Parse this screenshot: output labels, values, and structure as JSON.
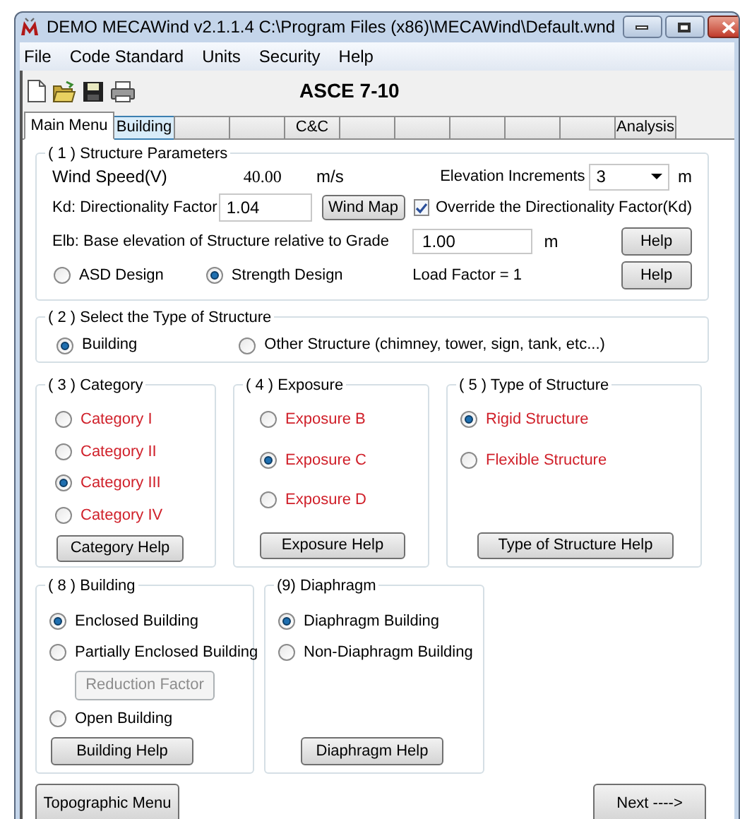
{
  "window": {
    "title": "DEMO MECAWind v2.1.1.4 C:\\Program Files (x86)\\MECAWind\\Default.wnd"
  },
  "menu": [
    "File",
    "Code Standard",
    "Units",
    "Security",
    "Help"
  ],
  "toolbar": {
    "title": "ASCE 7-10"
  },
  "tabs": [
    {
      "label": "Main Menu",
      "selected": true,
      "hover": false
    },
    {
      "label": "Building",
      "selected": false,
      "hover": true
    },
    {
      "selected": false,
      "hover": false
    },
    {
      "selected": false,
      "hover": false
    },
    {
      "label": "C&C",
      "selected": false,
      "hover": false
    },
    {
      "selected": false,
      "hover": false
    },
    {
      "selected": false,
      "hover": false
    },
    {
      "selected": false,
      "hover": false
    },
    {
      "selected": false,
      "hover": false
    },
    {
      "selected": false,
      "hover": false
    },
    {
      "label": "Analysis",
      "selected": false,
      "hover": false
    }
  ],
  "structure_parameters": {
    "title": "( 1 ) Structure Parameters",
    "wind_speed": {
      "label": "Wind Speed(V)",
      "value": "40.00",
      "unit": "m/s"
    },
    "elevation_increments": {
      "label": "Elevation Increments",
      "value": "3",
      "unit": "m"
    },
    "kd": {
      "label": "Kd: Directionality Factor",
      "value": "1.04"
    },
    "wind_map_button": "Wind Map",
    "override": {
      "label": "Override the Directionality Factor(Kd)",
      "checked": true
    },
    "elb": {
      "label": "Elb: Base elevation of Structure relative to Grade",
      "value": "1.00",
      "unit": "m"
    },
    "help_buttons": [
      "Help",
      "Help"
    ],
    "design": [
      {
        "label": "ASD Design",
        "selected": false
      },
      {
        "label": "Strength Design",
        "selected": true
      }
    ],
    "load_factor": "Load Factor =  1"
  },
  "structure_type": {
    "title": "( 2 ) Select the Type of Structure",
    "options": [
      {
        "label": "Building",
        "selected": true
      },
      {
        "label": "Other Structure (chimney, tower,  sign, tank, etc...)",
        "selected": false
      }
    ]
  },
  "category": {
    "title": "( 3 ) Category",
    "highlighted": true,
    "options": [
      {
        "label": "Category I",
        "selected": false
      },
      {
        "label": "Category II",
        "selected": false
      },
      {
        "label": "Category III",
        "selected": true
      },
      {
        "label": "Category IV",
        "selected": false
      }
    ],
    "help_button": "Category Help"
  },
  "exposure": {
    "title": "( 4 ) Exposure",
    "highlighted": true,
    "options": [
      {
        "label": "Exposure B",
        "selected": false
      },
      {
        "label": "Exposure C",
        "selected": true
      },
      {
        "label": "Exposure D",
        "selected": false
      }
    ],
    "help_button": "Exposure Help"
  },
  "type_of_structure": {
    "title": "( 5 ) Type of Structure",
    "highlighted": true,
    "options": [
      {
        "label": "Rigid Structure",
        "selected": true
      },
      {
        "label": "Flexible Structure",
        "selected": false
      }
    ],
    "help_button": "Type of Structure Help"
  },
  "building": {
    "title": "( 8 ) Building",
    "items": [
      {
        "kind": "radio",
        "label": "Enclosed Building",
        "selected": true
      },
      {
        "kind": "radio",
        "label": "Partially Enclosed Building",
        "selected": false
      },
      {
        "kind": "button",
        "label": "Reduction Factor",
        "disabled": true
      },
      {
        "kind": "radio",
        "label": "Open Building",
        "selected": false
      }
    ],
    "help_button": "Building Help"
  },
  "diaphragm": {
    "title": "(9) Diaphragm",
    "items": [
      {
        "kind": "radio",
        "label": "Diaphragm Building",
        "selected": true
      },
      {
        "kind": "radio",
        "label": "Non-Diaphragm Building",
        "selected": false
      }
    ],
    "help_button": "Diaphragm Help"
  },
  "topographic_button": "Topographic Menu",
  "next_button": "Next ---->"
}
